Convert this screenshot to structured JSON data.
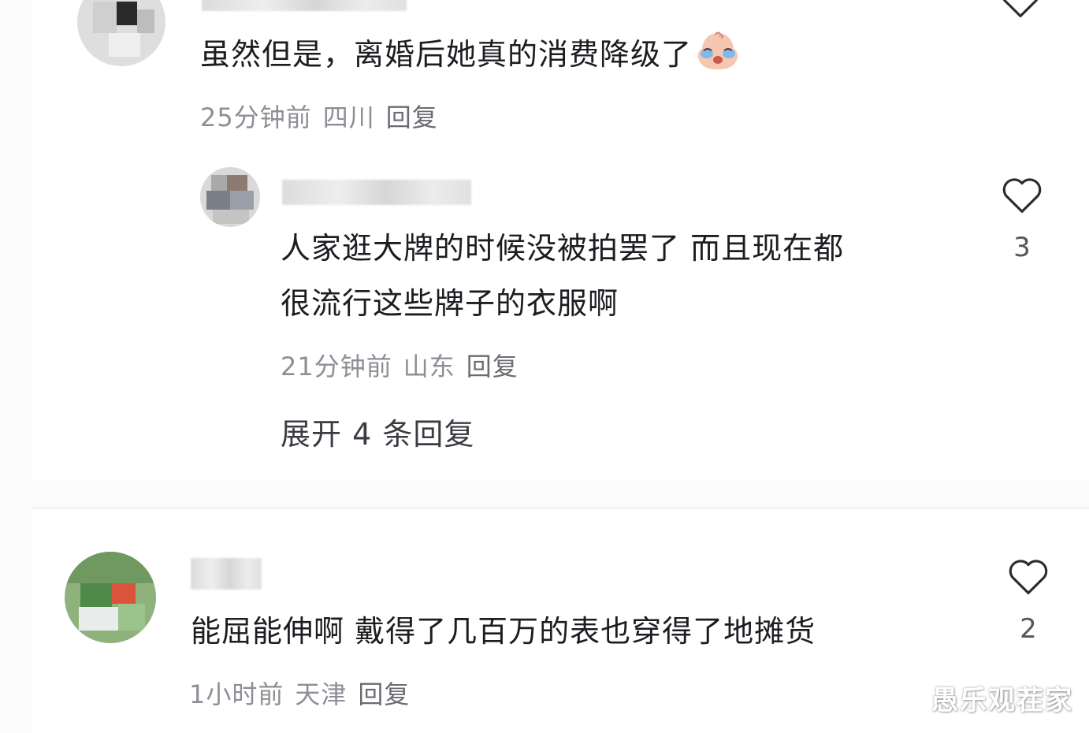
{
  "comments": [
    {
      "text": "虽然但是，离婚后她真的消费降级了",
      "emoji": "crying-face-icon",
      "time": "25分钟前",
      "location": "四川",
      "reply_label": "回复"
    },
    {
      "text_line1": "人家逛大牌的时候没被拍罢了 而且现在都",
      "text_line2": "很流行这些牌子的衣服啊",
      "time": "21分钟前",
      "location": "山东",
      "reply_label": "回复",
      "likes": "3",
      "expand_label": "展开 4 条回复"
    },
    {
      "text": "能屈能伸啊 戴得了几百万的表也穿得了地摊货",
      "time": "1小时前",
      "location": "天津",
      "reply_label": "回复",
      "likes": "2"
    }
  ],
  "watermark": "愚乐观茬家",
  "colors": {
    "text": "#1c1c21",
    "meta": "#8e8e96",
    "heart_stroke": "#2a2a30"
  }
}
